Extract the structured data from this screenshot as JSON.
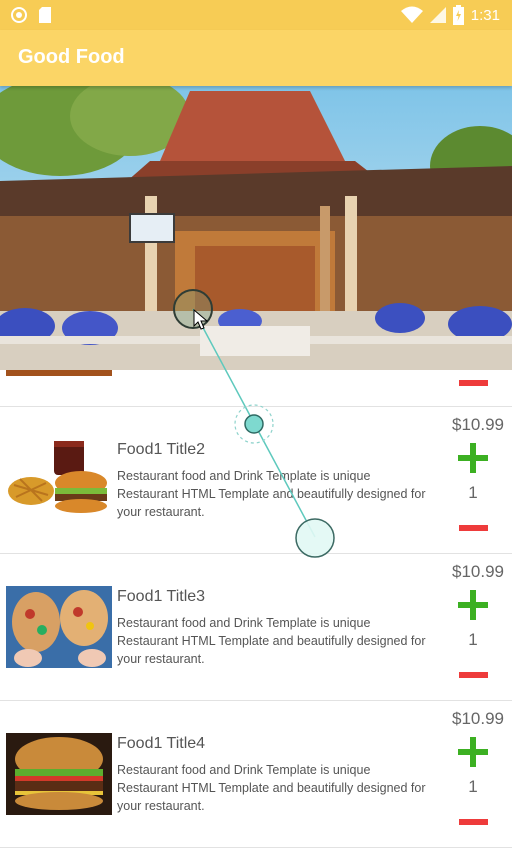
{
  "statusbar": {
    "time": "1:31",
    "left_icons": [
      "sync-icon",
      "sd-card-icon"
    ],
    "right_icons": [
      "wifi-icon",
      "signal-icon",
      "battery-charging-icon"
    ]
  },
  "appbar": {
    "title": "Good Food"
  },
  "colors": {
    "appbar": "#fbd566",
    "statusbar": "#f7cc55",
    "plus": "#3cb022",
    "minus": "#ee3b3b"
  },
  "items": [
    {
      "title": "Food1 Title2",
      "description": "Restaurant food and Drink Template is unique Restaurant HTML Template and beautifully designed for your restaurant.",
      "price": "$10.99",
      "quantity": "1"
    },
    {
      "title": "Food1 Title3",
      "description": "Restaurant food and Drink Template is unique Restaurant HTML Template and beautifully designed for your restaurant.",
      "price": "$10.99",
      "quantity": "1"
    },
    {
      "title": "Food1 Title4",
      "description": "Restaurant food and Drink Template is unique Restaurant HTML Template and beautifully designed for your restaurant.",
      "price": "$10.99",
      "quantity": "1"
    }
  ]
}
